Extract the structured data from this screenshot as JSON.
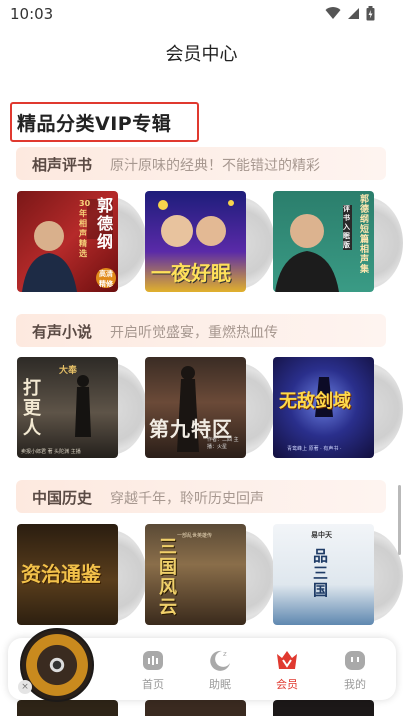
{
  "status_bar": {
    "time": "10:03"
  },
  "header": {
    "title": "会员中心"
  },
  "section": {
    "title": "精品分类VIP专辑"
  },
  "categories": [
    {
      "name": "相声评书",
      "desc": "原汁原味的经典！不能错过的精彩",
      "albums": [
        {
          "text_main": "郭德纲",
          "text_sub": "30年相声精选",
          "badge": "高清精修"
        },
        {
          "text_main": "一夜好眠"
        },
        {
          "text_main": "郭德纲短篇相声集",
          "text_sub": "评书入眠版"
        }
      ]
    },
    {
      "name": "有声小说",
      "desc": "开启听觉盛宴，重燃热血传",
      "albums": [
        {
          "text_main": "打更人",
          "text_top": "大奉",
          "text_sub": "卖报小郎君 著  头陀渊 主播"
        },
        {
          "text_main": "第九特区",
          "text_sub": "作者：二四  主播：火星"
        },
        {
          "text_main": "无敌剑域",
          "text_sub": "青鸾峰上 原著  · 有声书 ·"
        }
      ]
    },
    {
      "name": "中国历史",
      "desc": "穿越千年，聆听历史回声",
      "albums": [
        {
          "text_main": "资治通鉴"
        },
        {
          "text_main": "三国风云",
          "text_sub": "一部乱世英雄传"
        },
        {
          "text_main": "品三国",
          "text_top": "易中天"
        }
      ]
    }
  ],
  "tabs": [
    {
      "label": "首页",
      "icon": "home-icon"
    },
    {
      "label": "助眠",
      "icon": "sleep-moon-icon"
    },
    {
      "label": "会员",
      "icon": "vip-crown-icon",
      "active": true
    },
    {
      "label": "我的",
      "icon": "profile-icon"
    }
  ],
  "mini_player": {
    "close": "×"
  },
  "colors": {
    "accent": "#e0392f",
    "banner_bg": "#fdece4",
    "tab_inactive": "#9a9a9a"
  }
}
